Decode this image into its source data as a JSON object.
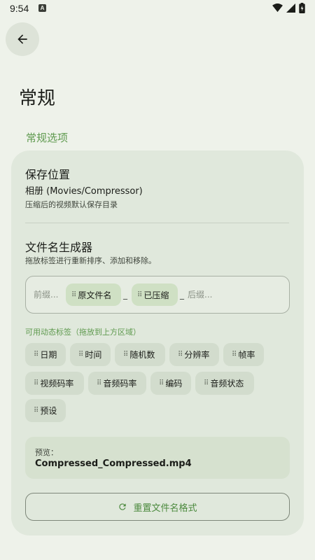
{
  "status_bar": {
    "time": "9:54",
    "notification_letter": "A",
    "icons": [
      "wifi-icon",
      "signal-icon",
      "battery-icon"
    ]
  },
  "header": {
    "back_icon": "arrow-left-icon",
    "title": "常规"
  },
  "section": {
    "label": "常规选项"
  },
  "save_location": {
    "title": "保存位置",
    "value": "相册 (Movies/Compressor)",
    "description": "压缩后的视频默认保存目录"
  },
  "filename_generator": {
    "title": "文件名生成器",
    "description": "拖放标签进行重新排序、添加和移除。",
    "prefix_placeholder": "前缀...",
    "suffix_placeholder": "后缀...",
    "separator": "_",
    "active_tags": [
      "原文件名",
      "已压缩"
    ]
  },
  "available_tags": {
    "label": "可用动态标签（拖放到上方区域）",
    "tags": [
      "日期",
      "时间",
      "随机数",
      "分辨率",
      "帧率",
      "视频码率",
      "音频码率",
      "编码",
      "音频状态",
      "预设"
    ]
  },
  "preview": {
    "label": "预览：",
    "value": "Compressed_Compressed.mp4"
  },
  "reset_button": {
    "label": "重置文件名格式",
    "icon": "refresh-icon"
  },
  "colors": {
    "accent": "#5f9a4f",
    "background": "#eef2ea",
    "card": "#e0e8dc",
    "chip_active": "#cfe0c4"
  }
}
